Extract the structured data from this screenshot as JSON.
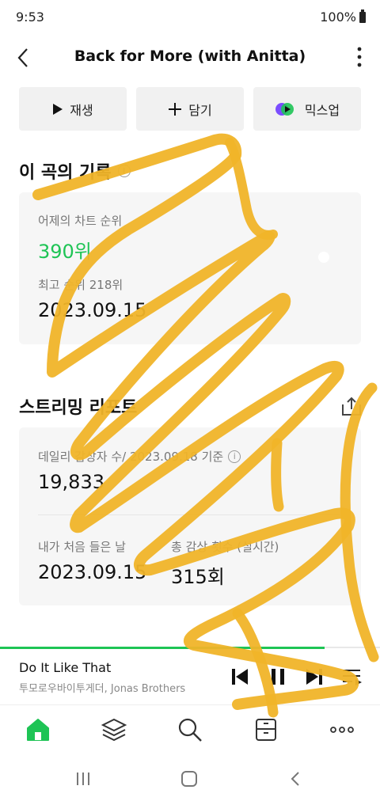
{
  "status": {
    "time": "9:53",
    "battery": "100%"
  },
  "header": {
    "title": "Back for More (with Anitta)"
  },
  "actions": {
    "play": "재생",
    "add": "담기",
    "mixup": "믹스업"
  },
  "record": {
    "title": "이 곡의 기록",
    "chart_label": "어제의 차트 순위",
    "chart_rank": "390위",
    "peak_label": "최고 순위 218위",
    "peak_date": "2023.09.15"
  },
  "stream": {
    "title": "스트리밍 리포트",
    "daily_label": "데일리 감상자 수/ 2023.09.18 기준",
    "daily_value": "19,833",
    "first_label": "내가 처음 들은 날",
    "first_value": "2023.09.15",
    "total_label": "총 감상 횟수 (실시간)",
    "total_value": "315회"
  },
  "player": {
    "title": "Do It Like That",
    "artist": "투모로우바이투게더, Jonas Brothers",
    "progress": 0.855
  },
  "nav": {
    "items": [
      "home-icon",
      "layers-icon",
      "search-icon",
      "library-icon",
      "more-icon"
    ]
  },
  "colors": {
    "accent": "#1ec455",
    "scribble": "#f0b429"
  }
}
